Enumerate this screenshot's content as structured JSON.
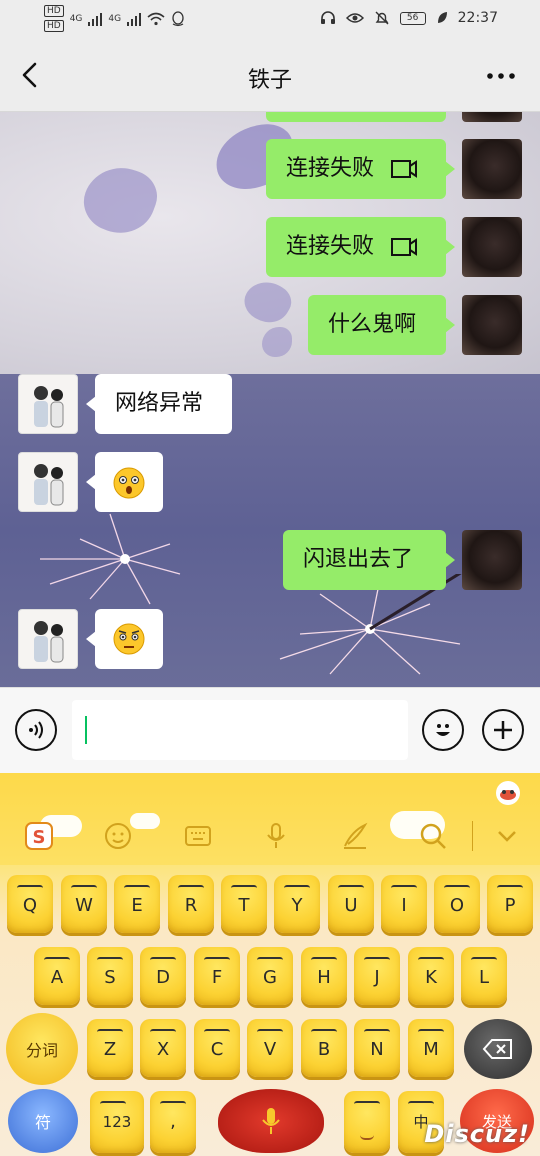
{
  "status_bar": {
    "hd1": "HD",
    "hd2": "HD",
    "net1": "4G",
    "net2": "4G",
    "battery": "56",
    "time": "22:37"
  },
  "nav": {
    "title": "铁子"
  },
  "messages": [
    {
      "side": "me",
      "text": "连接失败",
      "type": "voice-call"
    },
    {
      "side": "me",
      "text": "连接失败",
      "type": "voice-call"
    },
    {
      "side": "me",
      "text": "什么鬼啊",
      "type": "text"
    },
    {
      "side": "friend",
      "text": "网络异常",
      "type": "text"
    },
    {
      "side": "friend",
      "text": "",
      "type": "emoji",
      "emoji": "surprised-face"
    },
    {
      "side": "me",
      "text": "闪退出去了",
      "type": "text"
    },
    {
      "side": "friend",
      "text": "",
      "type": "emoji",
      "emoji": "annoyed-face"
    }
  ],
  "input": {
    "value": "",
    "placeholder": ""
  },
  "keyboard": {
    "row1": [
      "Q",
      "W",
      "E",
      "R",
      "T",
      "Y",
      "U",
      "I",
      "O",
      "P"
    ],
    "row2": [
      "A",
      "S",
      "D",
      "F",
      "G",
      "H",
      "J",
      "K",
      "L"
    ],
    "row3": [
      "Z",
      "X",
      "C",
      "V",
      "B",
      "N",
      "M"
    ],
    "fenci_label": "分词",
    "symbol_label": "符",
    "num_label": "123",
    "zh_label": "中",
    "send_label": "发送",
    "punct_label": ",",
    "toolbar_icons": [
      "sogou-logo-icon",
      "emoji-icon",
      "keyboard-icon",
      "microphone-icon",
      "handwrite-icon",
      "search-icon",
      "collapse-icon"
    ]
  },
  "watermark": "Discuz!",
  "colors": {
    "bubble_green": "#95ec69",
    "caret": "#07c160",
    "keyboard_yellow": "#fcd233"
  }
}
